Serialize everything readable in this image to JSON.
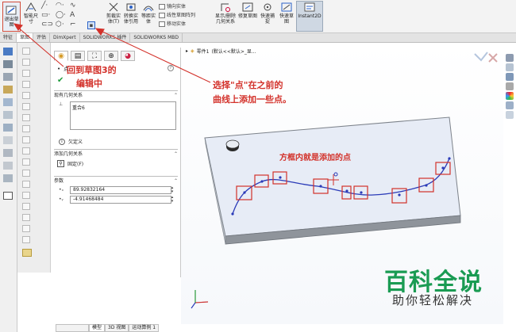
{
  "ribbon": {
    "exit_sketch_label": "退出草图",
    "smart_dim_label": "智能尺寸",
    "trim_label": "剪裁实体(T)",
    "convert_label": "转换实体引用",
    "offset_label": "等距实体",
    "mirror_label": "镜向实体",
    "linear_pattern_label": "线性草图阵列",
    "move_label": "移动实体",
    "relations_label": "显示/删除几何关系",
    "repair_label": "修复草图",
    "quick_snaps_label": "快速捕捉",
    "rapid_sketch_label": "快速草图",
    "instant2d_label": "Instant2D"
  },
  "tabs": [
    "特征",
    "草图",
    "评估",
    "DimXpert",
    "SOLIDWORKS 插件",
    "SOLIDWORKS MBD"
  ],
  "active_tab_index": 1,
  "property_manager": {
    "title": "点",
    "existing_relations_heading": "现有几何关系",
    "existing_relations": [
      "重合6"
    ],
    "status_text": "欠定义",
    "add_relations_heading": "添加几何关系",
    "fix_label": "固定(F)",
    "params_heading": "参数",
    "x_value": "89.92832164",
    "y_value": "-4.91468484"
  },
  "crumb": {
    "part_label": "零件1",
    "config_label": "(默认<<默认>_显..."
  },
  "annotations": {
    "back_to_sketch": "回到草图3的",
    "edit_in": "编辑中",
    "select_point_1": "选择\"点\"在之前的",
    "select_point_2": "曲线上添加一些点。",
    "boxes_note": "方框内就是添加的点"
  },
  "watermark": {
    "main": "百科全说",
    "sub": "助你轻松解决"
  },
  "bottom_tabs": [
    "",
    "模型",
    "3D 视图",
    "运动算例 1"
  ],
  "colors": {
    "annotation_red": "#d3312a",
    "curve_blue": "#2b3bb8",
    "watermark_green": "#1a9b53",
    "plate_face": "#e7ecf6",
    "plate_edge": "#7c828a"
  }
}
